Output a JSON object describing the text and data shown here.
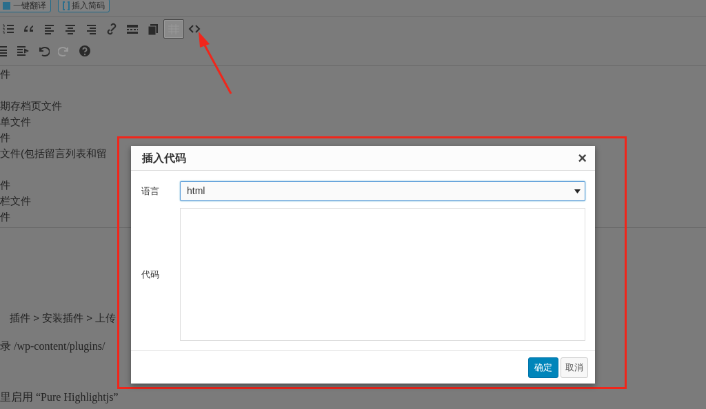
{
  "editor_buttons": [
    {
      "label": "一键翻译",
      "kind": "translate"
    },
    {
      "label": "插入简码",
      "kind": "shortcode"
    }
  ],
  "toolbar_rows": [
    [
      {
        "kind": "ordered-list",
        "disabled": false,
        "highlighted": false
      },
      {
        "kind": "blockquote",
        "disabled": false,
        "highlighted": false
      },
      {
        "kind": "align-left",
        "disabled": false,
        "highlighted": false
      },
      {
        "kind": "align-center",
        "disabled": false,
        "highlighted": false
      },
      {
        "kind": "align-right",
        "disabled": false,
        "highlighted": false
      },
      {
        "kind": "link",
        "disabled": false,
        "highlighted": false
      },
      {
        "kind": "more",
        "disabled": false,
        "highlighted": false
      },
      {
        "kind": "pages",
        "disabled": false,
        "highlighted": false
      },
      {
        "kind": "table",
        "disabled": false,
        "highlighted": true
      },
      {
        "kind": "code",
        "disabled": false,
        "highlighted": false
      }
    ],
    [
      {
        "kind": "outdent",
        "disabled": false,
        "highlighted": false
      },
      {
        "kind": "indent",
        "disabled": false,
        "highlighted": false
      },
      {
        "kind": "undo",
        "disabled": false,
        "highlighted": false
      },
      {
        "kind": "redo",
        "disabled": true,
        "highlighted": false
      },
      {
        "kind": "help",
        "disabled": false,
        "highlighted": false
      }
    ]
  ],
  "paragraphs": [
    [
      "件"
    ],
    [
      "期存档页文件",
      "单文件",
      "件",
      "文件(包括留言列表和留"
    ],
    [
      "件",
      "栏文件",
      "件"
    ]
  ],
  "lower_lines": [
    {
      "text": "插件 > 安装插件 > 上传",
      "kind": "sans"
    },
    {
      "text": "录 /wp-content/plugins/",
      "kind": "serif"
    },
    {
      "text": "里启用 “Pure Highlightjs”",
      "kind": "serif"
    }
  ],
  "dialog": {
    "title": "插入代码",
    "close": "×",
    "fields": [
      {
        "kind": "select",
        "label": "语言",
        "value": "html"
      },
      {
        "kind": "textarea",
        "label": "代码"
      }
    ],
    "buttons": [
      {
        "label": "确定",
        "kind": "primary"
      },
      {
        "label": "取消",
        "kind": "default"
      }
    ]
  }
}
